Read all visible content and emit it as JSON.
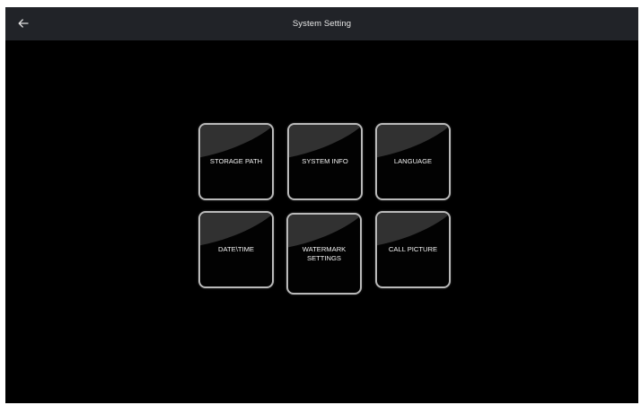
{
  "header": {
    "title": "System Setting",
    "back_icon": "arrow-left-icon"
  },
  "colors": {
    "background": "#000000",
    "titlebar": "#212328",
    "tile_border": "#b9b9b9",
    "text": "#f2f2f2"
  },
  "menu": {
    "items": [
      {
        "label": "STORAGE PATH"
      },
      {
        "label": "SYSTEM INFO"
      },
      {
        "label": "LANGUAGE"
      },
      {
        "label": "DATE\\TIME"
      },
      {
        "label": "WATERMARK\nSETTINGS"
      },
      {
        "label": "CALL PICTURE"
      }
    ]
  }
}
